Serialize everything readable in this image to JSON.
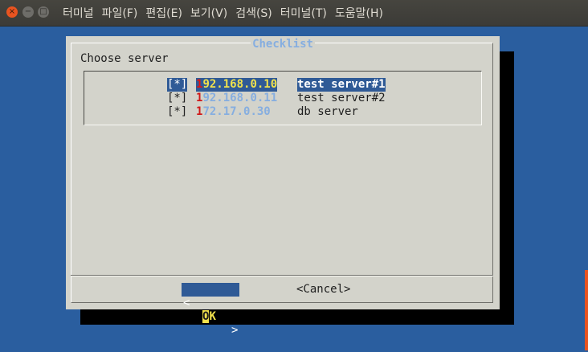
{
  "window": {
    "close_glyph": "×",
    "minimize_glyph": "−",
    "maximize_glyph": "□"
  },
  "menu": [
    "터미널",
    "파일(F)",
    "편집(E)",
    "보기(V)",
    "검색(S)",
    "터미널(T)",
    "도움말(H)"
  ],
  "dialog": {
    "title": "Checklist",
    "prompt": "Choose server",
    "items": [
      {
        "check": "[*]",
        "ip_first": "1",
        "ip_rest": "92.168.0.10",
        "desc": "test server#1",
        "selected": true
      },
      {
        "check": "[*]",
        "ip_first": "1",
        "ip_rest": "92.168.0.11",
        "desc": "test server#2",
        "selected": false
      },
      {
        "check": "[*]",
        "ip_first": "1",
        "ip_rest": "72.17.0.30",
        "desc": "db server",
        "selected": false
      }
    ],
    "ok_button": {
      "left": "<",
      "hotkey": "O",
      "rest": "K",
      "right": ">"
    },
    "cancel_button": "<Cancel>"
  },
  "colors": {
    "terminal_bg": "#2a5e9f",
    "dialog_bg": "#d3d3cb",
    "title": "#86aee0",
    "selection": "#2f5a96",
    "hotkey_yellow": "#f2e24c",
    "hotkey_red": "#d01919"
  }
}
